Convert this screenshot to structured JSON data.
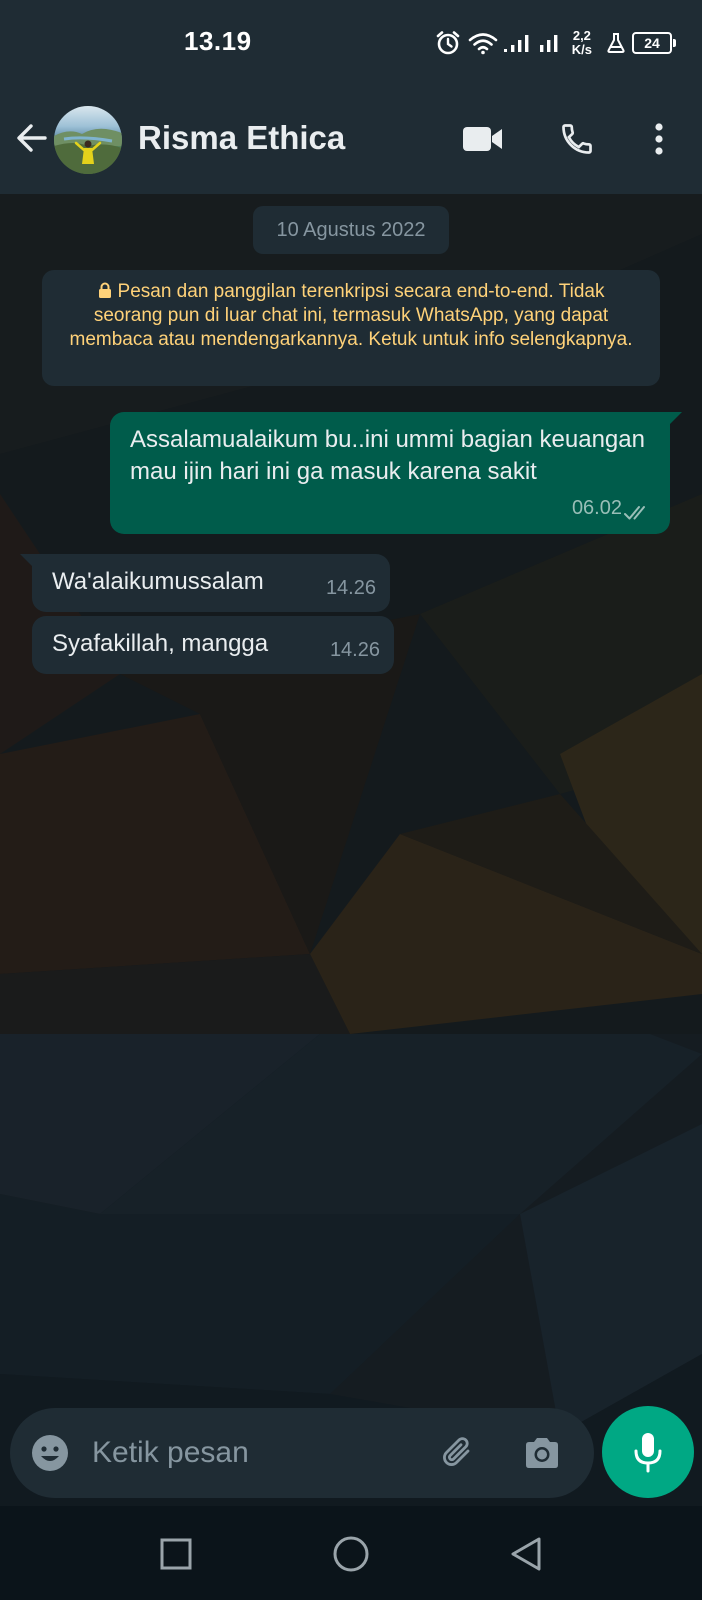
{
  "status_bar": {
    "time": "13.19",
    "net_speed_value": "2,2",
    "net_speed_unit": "K/s",
    "battery_level": "24",
    "icons": [
      "alarm-icon",
      "wifi-icon",
      "signal-icon",
      "signal-icon",
      "lab-icon",
      "battery-icon"
    ]
  },
  "header": {
    "contact_name": "Risma Ethica",
    "icons": [
      "back-arrow-icon",
      "video-call-icon",
      "phone-icon",
      "more-vert-icon"
    ]
  },
  "chat": {
    "date_label": "10 Agustus 2022",
    "encryption_notice": "Pesan dan panggilan terenkripsi secara end-to-end. Tidak seorang pun di luar chat ini, termasuk WhatsApp, yang dapat membaca atau mendengarkannya. Ketuk untuk info selengkapnya.",
    "messages": [
      {
        "direction": "outgoing",
        "text": "Assalamualaikum bu..ini ummi bagian keuangan mau ijin hari ini ga masuk karena sakit",
        "time": "06.02",
        "status": "delivered"
      },
      {
        "direction": "incoming",
        "text": "Wa'alaikumussalam",
        "time": "14.26"
      },
      {
        "direction": "incoming",
        "text": "Syafakillah, mangga",
        "time": "14.26"
      }
    ]
  },
  "composer": {
    "placeholder": "Ketik pesan",
    "icons": [
      "emoji-icon",
      "attach-icon",
      "camera-icon",
      "mic-icon"
    ]
  },
  "nav_bar": {
    "icons": [
      "recents-square-icon",
      "home-circle-icon",
      "back-triangle-icon"
    ]
  },
  "colors": {
    "header_bg": "#1f2c34",
    "chat_bg": "#0b141a",
    "outgoing_bubble": "#005c4b",
    "incoming_bubble": "#1f2c34",
    "accent": "#00a884",
    "notice_text": "#ffd279"
  }
}
